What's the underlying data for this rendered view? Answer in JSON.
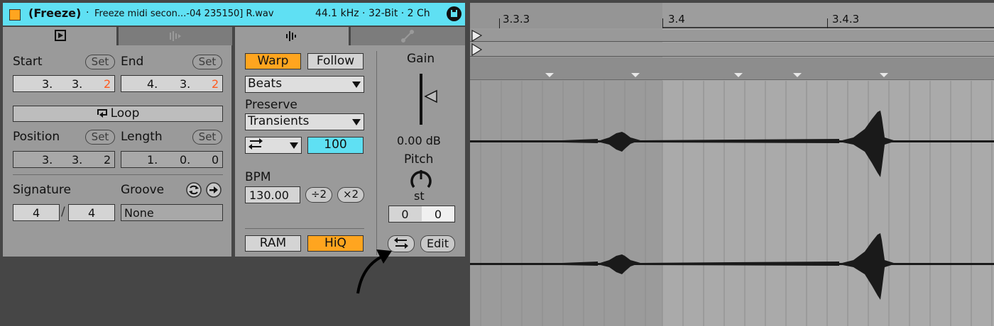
{
  "title_bar": {
    "clip_name": "(Freeze)",
    "separator": "·",
    "file_name": "Freeze midi secon...-04 235150] R.wav",
    "info": "44.1 kHz · 32-Bit · 2 Ch",
    "accent_color": "#5fe0f3",
    "clip_color": "#ffa51f"
  },
  "clip_panel": {
    "start_label": "Start",
    "end_label": "End",
    "set_label": "Set",
    "start_value": [
      "3.",
      "3.",
      "2"
    ],
    "end_value": [
      "4.",
      "3.",
      "2"
    ],
    "loop_label": "Loop",
    "position_label": "Position",
    "length_label": "Length",
    "position_value": [
      "3.",
      "3.",
      "2"
    ],
    "length_value": [
      "1.",
      "0.",
      "0"
    ],
    "signature_label": "Signature",
    "groove_label": "Groove",
    "sig_numerator": "4",
    "sig_slash": "/",
    "sig_denominator": "4",
    "groove_value": "None"
  },
  "sample_panel": {
    "warp_label": "Warp",
    "follow_label": "Follow",
    "warp_mode": "Beats",
    "preserve_label": "Preserve",
    "preserve_value": "Transients",
    "envelope_value": "100",
    "bpm_label": "BPM",
    "bpm_value": "130.00",
    "half_label": "÷2",
    "double_label": "×2",
    "ram_label": "RAM",
    "hiq_label": "HiQ",
    "gain_label": "Gain",
    "gain_value": "0.00 dB",
    "gain_level": 0.55,
    "pitch_label": "Pitch",
    "pitch_unit": "st",
    "coarse_value": "0",
    "fine_value": "0",
    "edit_label": "Edit"
  },
  "ruler": {
    "markers": [
      "3.3.3",
      "3.4",
      "3.4.3"
    ]
  },
  "colors": {
    "active_orange": "#ffa51f",
    "highlight_cyan": "#5fe0f3",
    "panel_gray": "#9a9a9a"
  }
}
